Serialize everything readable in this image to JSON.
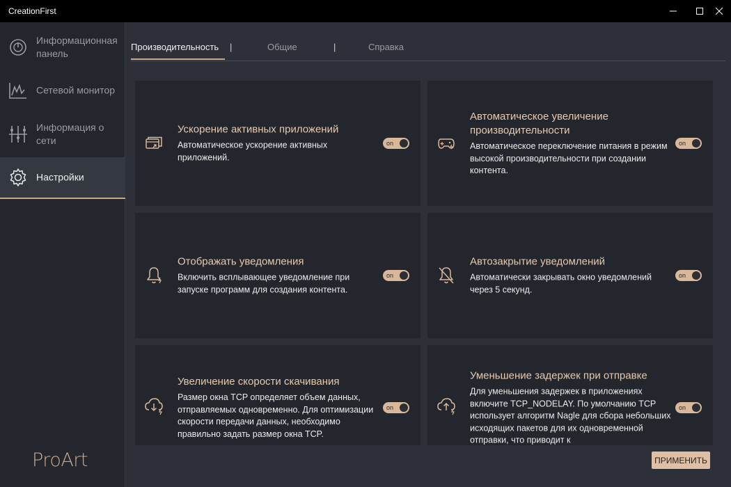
{
  "window": {
    "title": "CreationFirst"
  },
  "sidebar": {
    "items": [
      {
        "label": "Информационная панель"
      },
      {
        "label": "Сетевой монитор"
      },
      {
        "label": "Информация о сети"
      },
      {
        "label": "Настройки"
      }
    ],
    "active_index": 3,
    "brand": "ProArt"
  },
  "tabs": {
    "items": [
      {
        "label": "Производительность"
      },
      {
        "label": "Общие"
      },
      {
        "label": "Справка"
      }
    ],
    "separator": "|",
    "active_index": 0
  },
  "settings": {
    "cards": [
      {
        "icon": "app-acceleration-icon",
        "title": "Ускорение активных приложений",
        "description": "Автоматическое ускорение активных приложений.",
        "toggle": "on"
      },
      {
        "icon": "gamepad-boost-icon",
        "title": "Автоматическое увеличение производительности",
        "description": "Автоматическое переключение питания в режим высокой производительности при создании контента.",
        "toggle": "on"
      },
      {
        "icon": "bell-icon",
        "title": "Отображать уведомления",
        "description": "Включить всплывающее уведомление при запуске программ для создания контента.",
        "toggle": "on"
      },
      {
        "icon": "bell-off-icon",
        "title": "Автозакрытие уведомлений",
        "description": "Автоматически закрывать окно уведомлений через 5 секунд.",
        "toggle": "on"
      },
      {
        "icon": "cloud-download-icon",
        "title": "Увеличение скорости скачивания",
        "description": "Размер окна TCP определяет объем данных, отправляемых одновременно. Для оптимизации скорости передачи данных, необходимо правильно задать размер окна TCP.",
        "toggle": "on"
      },
      {
        "icon": "cloud-upload-icon",
        "title": "Уменьшение задержек при отправке",
        "description": "Для уменьшения задержек в приложениях включите TCP_NODELAY. По умолчанию TCP использует алгоритм Nagle для сбора небольших исходящих пакетов для их одновременной отправки, что приводит к",
        "toggle": "on"
      }
    ]
  },
  "footer": {
    "apply_label": "ПРИМЕНИТЬ"
  },
  "colors": {
    "accent": "#c9a789",
    "card_bg": "#23262d",
    "page_bg": "#2d3038"
  }
}
